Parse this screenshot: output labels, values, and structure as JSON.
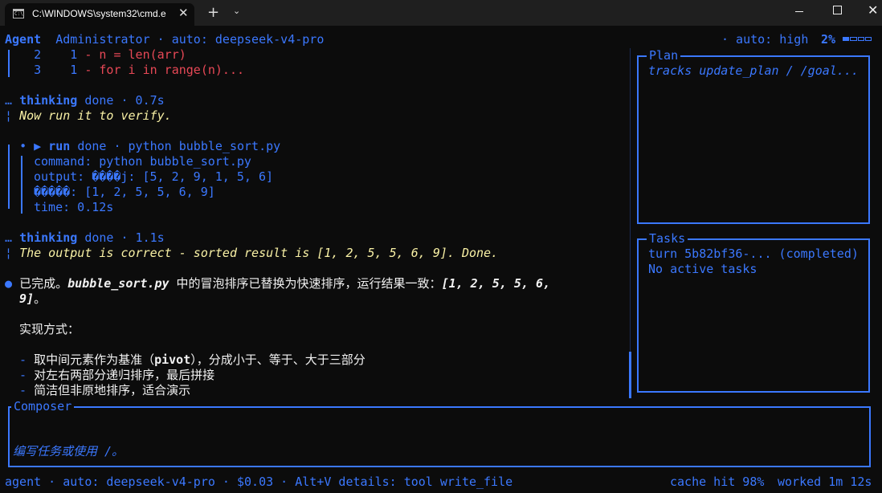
{
  "window": {
    "tab_title": "C:\\WINDOWS\\system32\\cmd.e",
    "tab_icon_text": "C:\\",
    "close_glyph": "✕",
    "new_tab_glyph": "+",
    "dropdown_glyph": "⌄",
    "window_close_glyph": "✕"
  },
  "header": {
    "agent": "Agent",
    "user": "Administrator",
    "dot": "·",
    "model": "auto: deepseek-v4-pro",
    "effort": "· auto: high",
    "percent": "2%",
    "progress_value": 0.25
  },
  "diff": [
    {
      "num": "2",
      "col": "1",
      "mark": "-",
      "code": "n = len(arr)"
    },
    {
      "num": "3",
      "col": "1",
      "mark": "-",
      "code": "for i in range(n)..."
    }
  ],
  "thinking1": {
    "prefix": "…",
    "label": "thinking",
    "status": "done",
    "time": "· 0.7s",
    "bar": "¦",
    "text": "Now run it to verify."
  },
  "run": {
    "bullet": "•",
    "arrow": "▶",
    "label": "run",
    "status": "done",
    "desc": "· python bubble_sort.py",
    "command": "command: python bubble_sort.py",
    "output": "output: ����j: [5, 2, 9, 1, 5, 6]",
    "output2": "�����: [1, 2, 5, 5, 6, 9]",
    "time": "time: 0.12s"
  },
  "thinking2": {
    "prefix": "…",
    "label": "thinking",
    "status": "done",
    "time": "· 1.1s",
    "bar": "¦",
    "text": "The output is correct - sorted result is [1, 2, 5, 5, 6, 9]. Done."
  },
  "message": {
    "bullet": "●",
    "p1": "已完成。",
    "file": "bubble_sort.py",
    "p2": " 中的冒泡排序已替换为快速排序，运行结果一致：",
    "result": "[1, 2, 5, 5, 6,",
    "result2": "9]",
    "p3": "。",
    "heading": "实现方式：",
    "items": [
      {
        "dash": "-",
        "a": "取中间元素作为基准（",
        "b": "pivot",
        "c": "），分成小于、等于、大于三部分"
      },
      {
        "dash": "-",
        "a": "对左右两部分递归排序，最后拼接",
        "b": "",
        "c": ""
      },
      {
        "dash": "-",
        "a": "简洁但非原地排序，适合演示",
        "b": "",
        "c": ""
      }
    ]
  },
  "plan": {
    "title": "Plan",
    "text": "tracks update_plan / /goal..."
  },
  "tasks": {
    "title": "Tasks",
    "line1": "turn 5b82bf36-... (completed)",
    "line2": "No active tasks"
  },
  "composer": {
    "title": "Composer",
    "placeholder": "编写任务或使用 /。"
  },
  "status_bar": {
    "left": "agent · auto: deepseek-v4-pro · $0.03 · Alt+V details: tool write_file",
    "cache": "cache hit 98%",
    "worked": "worked 1m 12s"
  },
  "colors": {
    "accent": "#3b78ff",
    "error": "#e74856",
    "thinking": "#f9f1a5",
    "background": "#0c0c0c"
  }
}
